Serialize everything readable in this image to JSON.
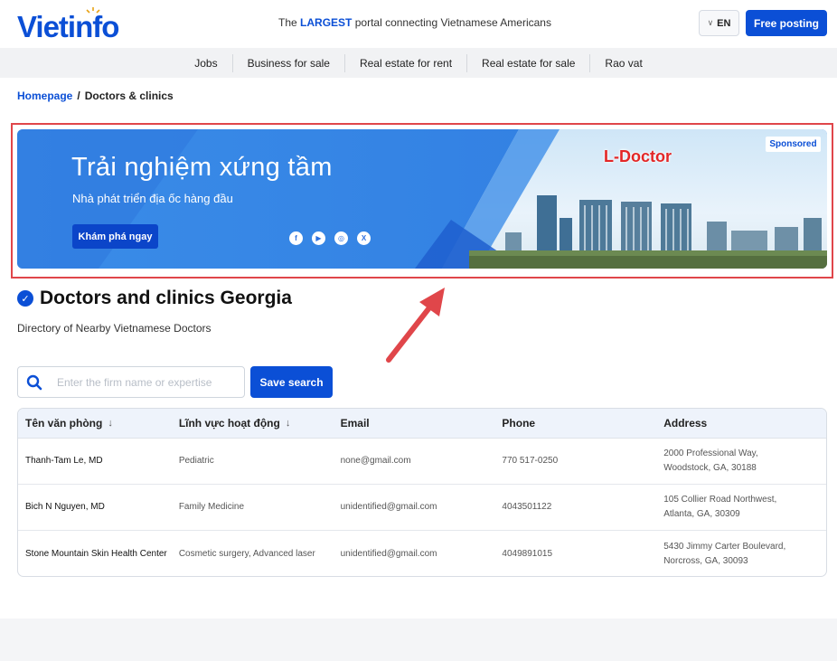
{
  "header": {
    "logo_text": "Vietinfo",
    "tagline_prefix": "The",
    "tagline_bold": "LARGEST",
    "tagline_suffix": "portal connecting Vietnamese Americans",
    "lang_label": "EN",
    "post_button": "Free posting"
  },
  "nav": {
    "items": [
      {
        "label": "Jobs"
      },
      {
        "label": "Business for sale"
      },
      {
        "label": "Real estate for rent"
      },
      {
        "label": "Real estate for sale"
      },
      {
        "label": "Rao vat"
      }
    ]
  },
  "breadcrumb": {
    "home": "Homepage",
    "separator": "/",
    "current": "Doctors & clinics"
  },
  "banner": {
    "title": "Trải nghiệm xứng tầm",
    "subtitle": "Nhà phát triển địa ốc hàng đầu",
    "cta": "Khám phá ngay",
    "brand": "L-Doctor",
    "sponsored": "Sponsored",
    "social": [
      {
        "icon": "facebook-icon",
        "glyph": "f"
      },
      {
        "icon": "youtube-icon",
        "glyph": "▶"
      },
      {
        "icon": "instagram-icon",
        "glyph": "◎"
      },
      {
        "icon": "x-icon",
        "glyph": "X"
      }
    ]
  },
  "page": {
    "title": "Doctors and clinics Georgia",
    "subtitle": "Directory of Nearby Vietnamese Doctors"
  },
  "search": {
    "placeholder": "Enter the firm name or expertise",
    "value": "",
    "button": "Save search"
  },
  "table": {
    "columns": [
      {
        "label": "Tên văn phòng",
        "sortable": true
      },
      {
        "label": "Lĩnh vực hoạt động",
        "sortable": true
      },
      {
        "label": "Email",
        "sortable": false
      },
      {
        "label": "Phone",
        "sortable": false
      },
      {
        "label": "Address",
        "sortable": false
      }
    ],
    "rows": [
      {
        "name": "Thanh-Tam Le, MD",
        "field": "Pediatric",
        "email": "none@gmail.com",
        "phone": "770 517-0250",
        "address_line1": "2000 Professional Way,",
        "address_line2": "Woodstock, GA, 30188"
      },
      {
        "name": "Bich N Nguyen, MD",
        "field": "Family Medicine",
        "email": "unidentified@gmail.com",
        "phone": "4043501122",
        "address_line1": "105 Collier Road Northwest,",
        "address_line2": "Atlanta, GA, 30309"
      },
      {
        "name": "Stone Mountain Skin Health Center",
        "field": "Cosmetic surgery, Advanced laser",
        "email": "unidentified@gmail.com",
        "phone": "4049891015",
        "address_line1": "5430 Jimmy Carter Boulevard,",
        "address_line2": "Norcross, GA, 30093"
      }
    ]
  },
  "colors": {
    "brand_blue": "#0b4fd6",
    "annotation_red": "#e0464a"
  }
}
